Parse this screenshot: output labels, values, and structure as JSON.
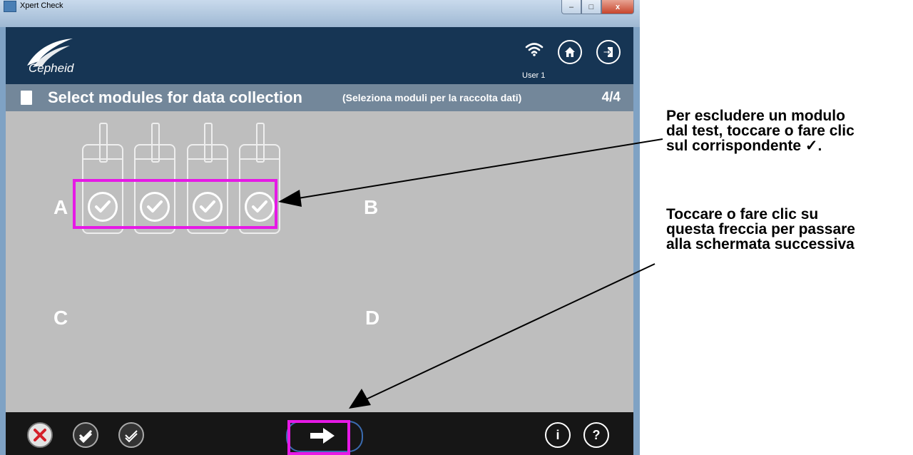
{
  "window": {
    "title": "Xpert Check",
    "minimize": "–",
    "maximize": "□",
    "close": "x"
  },
  "topbar": {
    "logo_text": "Cepheid",
    "user": "User 1",
    "icons": [
      "wifi-icon",
      "home-icon",
      "exit-icon"
    ]
  },
  "header": {
    "title": "Select modules for data collection",
    "subtitle": "(Seleziona moduli per la raccolta dati)",
    "page": "4/4"
  },
  "modules": {
    "groups": [
      "A",
      "B",
      "C",
      "D"
    ],
    "group_a_checked": [
      true,
      true,
      true,
      true
    ]
  },
  "bottombar": {
    "icons": [
      "cancel-icon",
      "select-all-icon",
      "deselect-all-icon",
      "next-arrow-icon",
      "info-icon",
      "help-icon"
    ],
    "info_label": "i",
    "help_label": "?"
  },
  "annotations": {
    "note1_line1": "Per escludere un modulo",
    "note1_line2": "dal test, toccare o fare clic",
    "note1_line3": "sul corrispondente ✓.",
    "note2_line1": "Toccare o fare clic su",
    "note2_line2": "questa freccia per passare",
    "note2_line3": "alla schermata successiva"
  },
  "colors": {
    "highlight": "#e619e6",
    "topbar": "#163554",
    "header": "#73879a",
    "panel": "#bebebe",
    "bottombar": "#161616"
  }
}
